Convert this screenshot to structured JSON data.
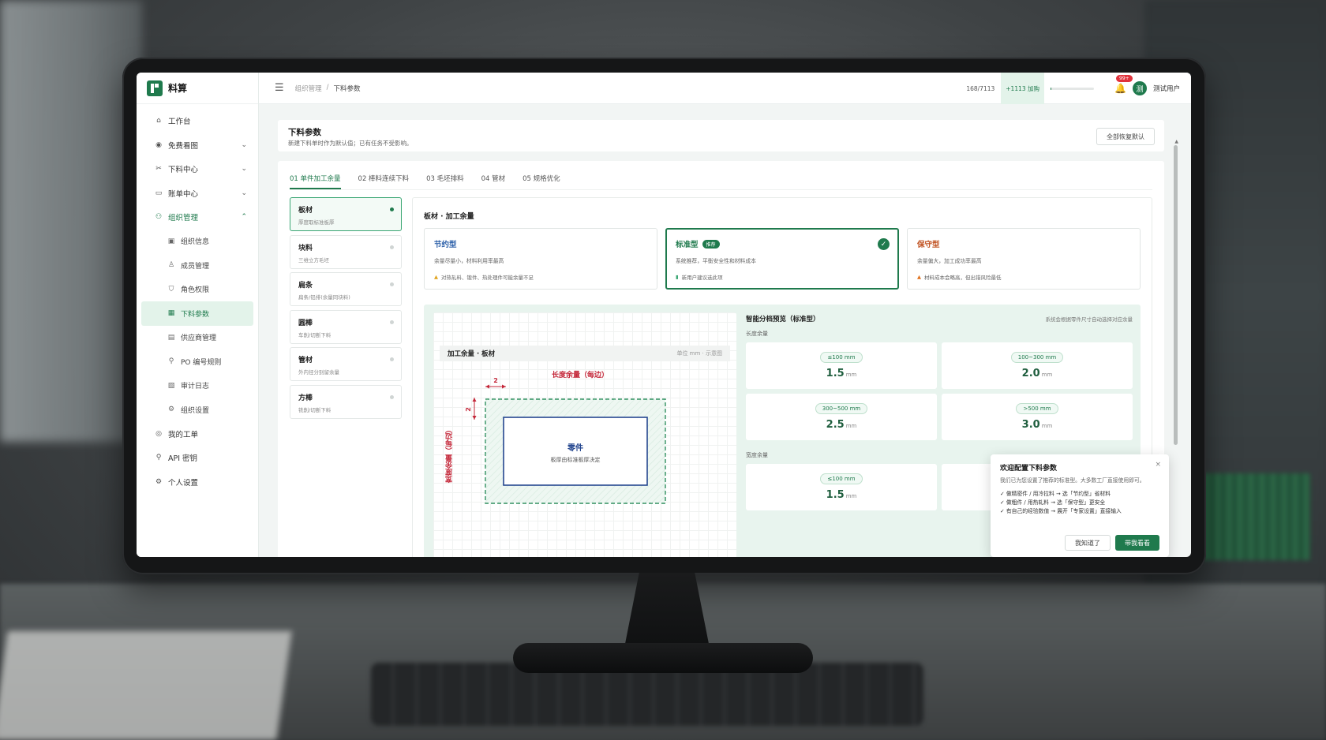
{
  "app": {
    "name": "料算"
  },
  "sidebar": {
    "items": [
      {
        "label": "工作台",
        "icon": "home-icon",
        "glyph": "⌂"
      },
      {
        "label": "免费看图",
        "icon": "eye-icon",
        "glyph": "◉",
        "chevron": "⌄"
      },
      {
        "label": "下料中心",
        "icon": "scissors-icon",
        "glyph": "✂",
        "chevron": "⌄"
      },
      {
        "label": "账单中心",
        "icon": "wallet-icon",
        "glyph": "▭",
        "chevron": "⌄"
      },
      {
        "label": "组织管理",
        "icon": "users-icon",
        "glyph": "⚇",
        "chevron": "⌃"
      }
    ],
    "sub_items": [
      {
        "label": "组织信息",
        "icon": "info-icon",
        "glyph": "▣"
      },
      {
        "label": "成员管理",
        "icon": "user-icon",
        "glyph": "♙"
      },
      {
        "label": "角色权限",
        "icon": "shield-icon",
        "glyph": "⛉"
      },
      {
        "label": "下料参数",
        "icon": "params-icon",
        "glyph": "▦"
      },
      {
        "label": "供应商管理",
        "icon": "supplier-icon",
        "glyph": "▤"
      },
      {
        "label": "PO 编号规则",
        "icon": "key-icon",
        "glyph": "⚲"
      },
      {
        "label": "审计日志",
        "icon": "log-icon",
        "glyph": "▧"
      },
      {
        "label": "组织设置",
        "icon": "gear-icon",
        "glyph": "⚙"
      }
    ],
    "bottom_items": [
      {
        "label": "我的工单",
        "icon": "ticket-icon",
        "glyph": "◎"
      },
      {
        "label": "API 密钥",
        "icon": "api-key-icon",
        "glyph": "⚲"
      },
      {
        "label": "个人设置",
        "icon": "settings-icon",
        "glyph": "⚙"
      }
    ]
  },
  "header": {
    "breadcrumb": [
      "组织管理",
      "下料参数"
    ],
    "separator": "/",
    "quota": "168/7113",
    "quota_add": "+1113 加购",
    "quota_fraction": 0.024,
    "notifications": "99+",
    "avatar_text": "测",
    "username": "测试用户"
  },
  "page": {
    "title": "下料参数",
    "desc": "新建下料单时作为默认值；已有任务不受影响。",
    "reset_label": "全部恢复默认"
  },
  "tabs": [
    "01 单件加工余量",
    "02 棒料连续下料",
    "03 毛坯排料",
    "04 管材",
    "05 规格优化"
  ],
  "materials": [
    {
      "name": "板材",
      "desc": "厚度取标准板厚"
    },
    {
      "name": "块料",
      "desc": "三维立方毛坯"
    },
    {
      "name": "扁条",
      "desc": "扁条/铝排(余量同块料)"
    },
    {
      "name": "圆棒",
      "desc": "车削/切断下料"
    },
    {
      "name": "管材",
      "desc": "外内径分别留余量"
    },
    {
      "name": "方棒",
      "desc": "铣削/切断下料"
    }
  ],
  "config": {
    "title": "板材 · 加工余量",
    "strategies": [
      {
        "name": "节约型",
        "desc": "余量尽量小，材料利用率最高",
        "note_icon": "▲",
        "note": "对热轧料、锻件、热处理件可能余量不足",
        "color": "#2a5ea8"
      },
      {
        "name": "标准型",
        "badge": "推荐",
        "desc": "系统推荐，平衡安全性和材料成本",
        "note_icon": "▮",
        "note": "新用户建议选此项",
        "color": "#1f7a4d",
        "check": "✓"
      },
      {
        "name": "保守型",
        "desc": "余量偏大，加工成功率最高",
        "note_icon": "▲",
        "note": "材料成本会略高，但出错风险最低",
        "color": "#c0501f"
      }
    ]
  },
  "diagram": {
    "title": "加工余量 · 板材",
    "unit": "单位 mm · 示意图",
    "length_label": "长度余量（每边）",
    "width_label": "宽度余量（每边）",
    "dim_h": "2",
    "dim_v": "2",
    "part_title": "零件",
    "part_sub": "板厚由标准板厚决定"
  },
  "smart": {
    "title": "智能分档预览（标准型）",
    "note": "系统会根据零件尺寸自动选择对应余量",
    "length_label": "长度余量",
    "width_label": "宽度余量",
    "unit": "mm",
    "length_rows": [
      {
        "range": "≤100 mm",
        "value": "1.5"
      },
      {
        "range": "100~300 mm",
        "value": "2.0"
      },
      {
        "range": "300~500 mm",
        "value": "2.5"
      },
      {
        "range": ">500 mm",
        "value": "3.0"
      }
    ],
    "width_rows": [
      {
        "range": "≤100 mm",
        "value": "1.5"
      }
    ]
  },
  "popup": {
    "title": "欢迎配置下料参数",
    "desc": "我们已为您设置了推荐的标准型。大多数工厂直接使用即可。",
    "tips": [
      "✓ 做精密件 / 用冷拉料 → 选「节约型」省材料",
      "✓ 做粗件 / 用热轧料 → 选「保守型」更安全",
      "✓ 有自己的经验数值 → 展开「专家设置」直接输入"
    ],
    "close": "×",
    "dismiss_label": "我知道了",
    "guide_label": "带我看看"
  },
  "colors": {
    "brand": "#1f7a4d",
    "danger": "#c4283a",
    "badge": "#e0323c"
  }
}
